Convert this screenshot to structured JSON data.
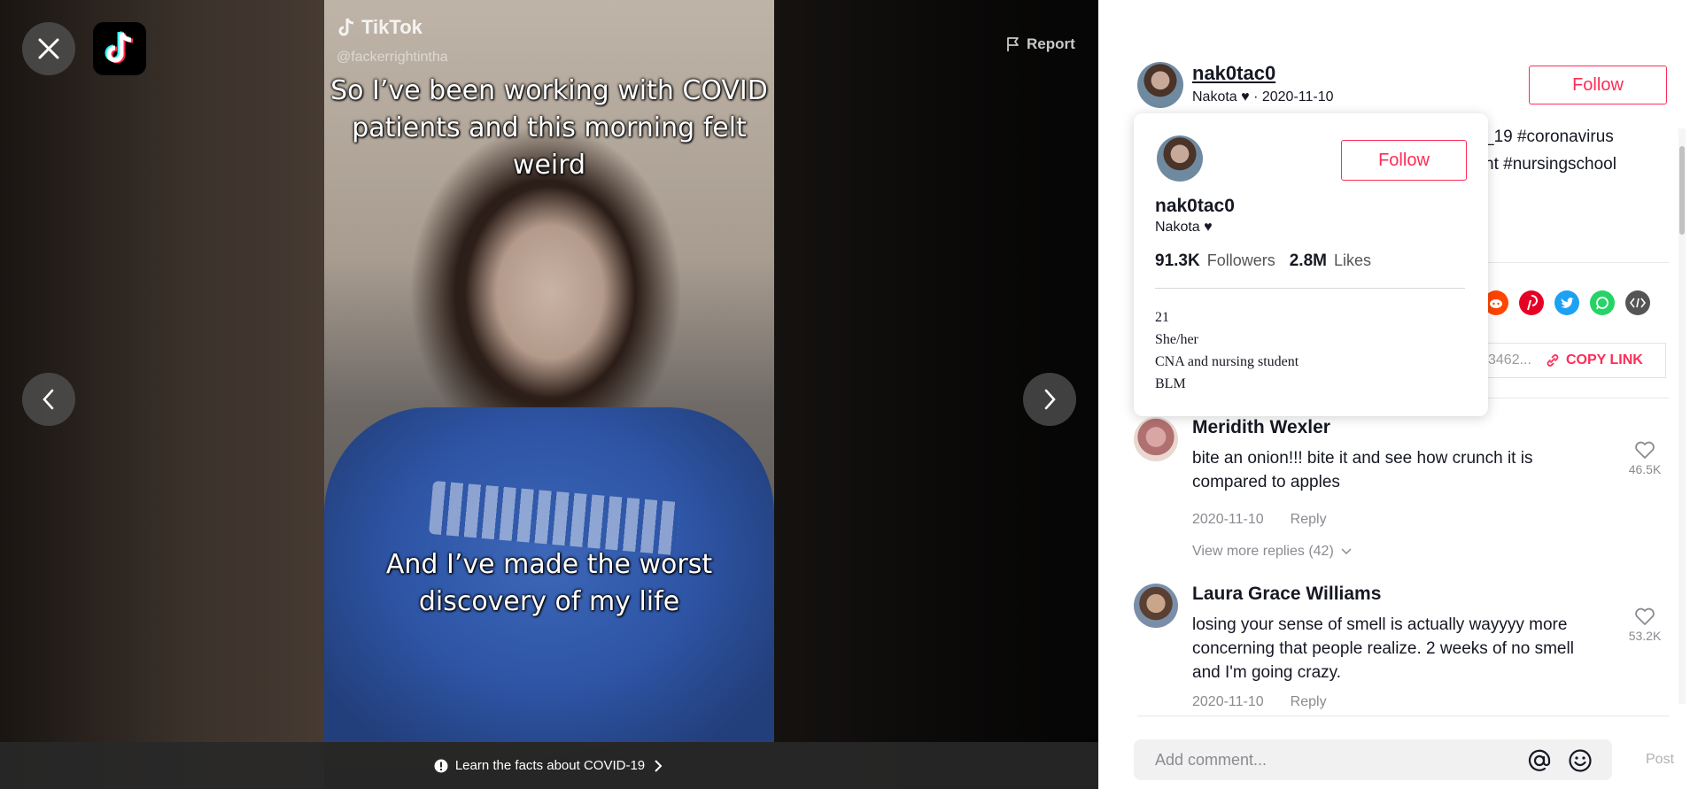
{
  "video": {
    "watermark_brand": "TikTok",
    "watermark_user": "@fackerrightintha",
    "caption_top": "So I’ve been working with COVID patients and this morning felt weird",
    "caption_bottom": "And I’ve made the worst discovery of my life",
    "report_label": "Report",
    "covid_banner": "Learn the facts about COVID-19"
  },
  "author": {
    "username": "nak0tac0",
    "subtitle": "Nakota ♥ · 2020-11-10",
    "follow_label": "Follow"
  },
  "description": {
    "line1": "_19 #coronavirus",
    "line2": "nt #nursingschool"
  },
  "share": {
    "icons": [
      "reddit-icon",
      "pinterest-icon",
      "twitter-icon",
      "whatsapp-icon",
      "embed-icon"
    ],
    "link_text": "3462...",
    "copy_label": "COPY LINK"
  },
  "profile_card": {
    "username": "nak0tac0",
    "subtitle": "Nakota ♥",
    "follow_label": "Follow",
    "followers_count": "91.3K",
    "followers_label": "Followers",
    "likes_count": "2.8M",
    "likes_label": "Likes",
    "bio": [
      "21",
      "She/her",
      "CNA and nursing student",
      "BLM"
    ]
  },
  "comments": [
    {
      "name": "Meridith Wexler",
      "text": "bite an onion!!! bite it and see how crunch it is compared to apples",
      "date": "2020-11-10",
      "reply_label": "Reply",
      "likes": "46.5K",
      "view_more": "View more replies (42)"
    },
    {
      "name": "Laura Grace Williams",
      "text": "losing your sense of smell is actually wayyyy more concerning that people realize. 2 weeks of no smell and I'm going crazy.",
      "date": "2020-11-10",
      "reply_label": "Reply",
      "likes": "53.2K"
    }
  ],
  "comment_input": {
    "placeholder": "Add comment...",
    "post_label": "Post"
  },
  "colors": {
    "accent": "#fe2c55",
    "text": "#161823",
    "muted": "#8a8b91"
  }
}
